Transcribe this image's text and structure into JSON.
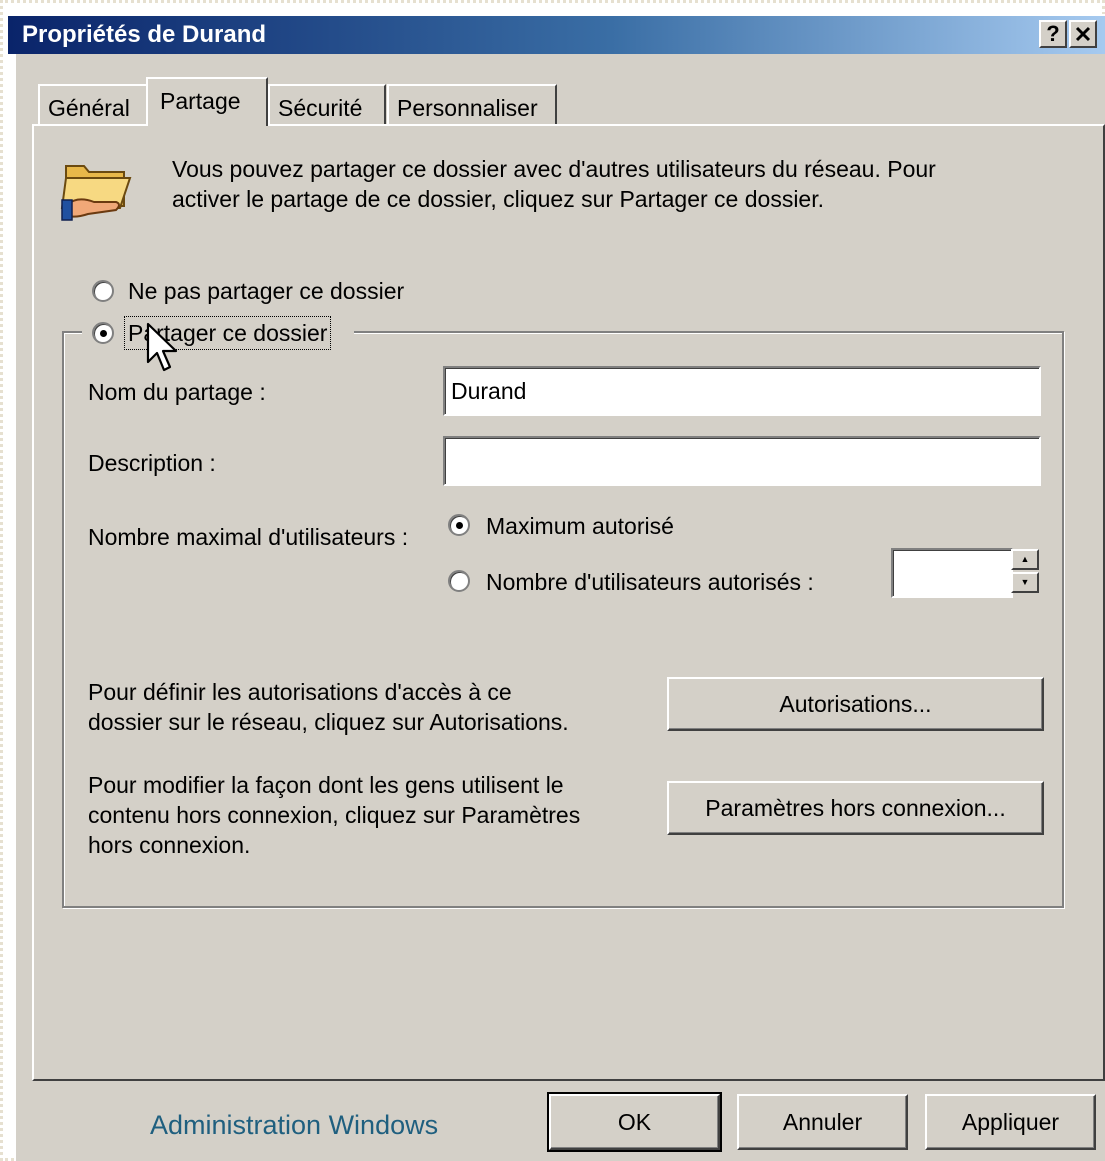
{
  "window": {
    "title": "Propriétés de Durand",
    "help_button": "?",
    "close_button": "✕"
  },
  "tabs": [
    {
      "label": "Général",
      "active": false
    },
    {
      "label": "Partage",
      "active": true
    },
    {
      "label": "Sécurité",
      "active": false
    },
    {
      "label": "Personnaliser",
      "active": false
    }
  ],
  "info": {
    "icon": "shared-folder-icon",
    "line1": "Vous pouvez partager ce dossier avec d'autres utilisateurs du réseau. Pour",
    "line2": "activer le partage de ce dossier, cliquez sur Partager ce dossier."
  },
  "sharing": {
    "no_share_label": "Ne pas partager ce dossier",
    "share_label": "Partager ce dossier",
    "selected": "share"
  },
  "share_name": {
    "label": "Nom du partage :",
    "value": "Durand"
  },
  "description": {
    "label": "Description :",
    "value": ""
  },
  "user_limit": {
    "label": "Nombre maximal d'utilisateurs :",
    "max_allowed_label": "Maximum autorisé",
    "allowed_users_label": "Nombre d'utilisateurs autorisés :",
    "selected": "max",
    "spinner_value": ""
  },
  "permissions": {
    "line1": "Pour définir les autorisations d'accès à ce",
    "line2": "dossier sur le réseau, cliquez sur Autorisations.",
    "button": "Autorisations..."
  },
  "offline": {
    "line1": "Pour modifier la façon dont les gens utilisent le",
    "line2": "contenu hors connexion, cliquez sur Paramètres",
    "line3": "hors connexion.",
    "button": "Paramètres hors connexion..."
  },
  "footer": {
    "caption": "Administration Windows",
    "ok": "OK",
    "cancel": "Annuler",
    "apply": "Appliquer"
  },
  "colors": {
    "titlebar_start": "#0a246a",
    "titlebar_end": "#a6caf0",
    "dialog_face": "#d4d0c8",
    "caption_text": "#1f5f7f"
  }
}
